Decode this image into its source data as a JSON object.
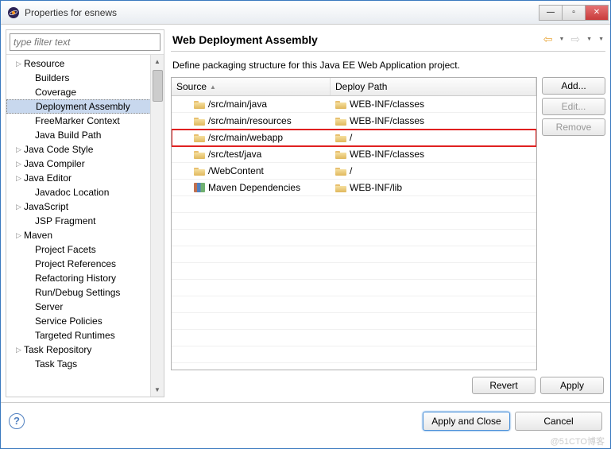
{
  "window": {
    "title": "Properties for esnews"
  },
  "filter": {
    "placeholder": "type filter text"
  },
  "tree": [
    {
      "label": "Resource",
      "expandable": true,
      "child": false
    },
    {
      "label": "Builders",
      "expandable": false,
      "child": true
    },
    {
      "label": "Coverage",
      "expandable": false,
      "child": true
    },
    {
      "label": "Deployment Assembly",
      "expandable": false,
      "child": true,
      "selected": true
    },
    {
      "label": "FreeMarker Context",
      "expandable": false,
      "child": true
    },
    {
      "label": "Java Build Path",
      "expandable": false,
      "child": true
    },
    {
      "label": "Java Code Style",
      "expandable": true,
      "child": false
    },
    {
      "label": "Java Compiler",
      "expandable": true,
      "child": false
    },
    {
      "label": "Java Editor",
      "expandable": true,
      "child": false
    },
    {
      "label": "Javadoc Location",
      "expandable": false,
      "child": true
    },
    {
      "label": "JavaScript",
      "expandable": true,
      "child": false
    },
    {
      "label": "JSP Fragment",
      "expandable": false,
      "child": true
    },
    {
      "label": "Maven",
      "expandable": true,
      "child": false
    },
    {
      "label": "Project Facets",
      "expandable": false,
      "child": true
    },
    {
      "label": "Project References",
      "expandable": false,
      "child": true
    },
    {
      "label": "Refactoring History",
      "expandable": false,
      "child": true
    },
    {
      "label": "Run/Debug Settings",
      "expandable": false,
      "child": true
    },
    {
      "label": "Server",
      "expandable": false,
      "child": true
    },
    {
      "label": "Service Policies",
      "expandable": false,
      "child": true
    },
    {
      "label": "Targeted Runtimes",
      "expandable": false,
      "child": true
    },
    {
      "label": "Task Repository",
      "expandable": true,
      "child": false
    },
    {
      "label": "Task Tags",
      "expandable": false,
      "child": true
    }
  ],
  "page": {
    "title": "Web Deployment Assembly",
    "description": "Define packaging structure for this Java EE Web Application project."
  },
  "table": {
    "headers": {
      "source": "Source",
      "deploy": "Deploy Path"
    },
    "rows": [
      {
        "source": "/src/main/java",
        "deploy": "WEB-INF/classes",
        "icon": "folder",
        "highlighted": false
      },
      {
        "source": "/src/main/resources",
        "deploy": "WEB-INF/classes",
        "icon": "folder",
        "highlighted": false
      },
      {
        "source": "/src/main/webapp",
        "deploy": "/",
        "icon": "folder",
        "highlighted": true
      },
      {
        "source": "/src/test/java",
        "deploy": "WEB-INF/classes",
        "icon": "folder",
        "highlighted": false
      },
      {
        "source": "/WebContent",
        "deploy": "/",
        "icon": "folder",
        "highlighted": false
      },
      {
        "source": "Maven Dependencies",
        "deploy": "WEB-INF/lib",
        "icon": "lib",
        "highlighted": false
      }
    ]
  },
  "buttons": {
    "add": "Add...",
    "edit": "Edit...",
    "remove": "Remove",
    "revert": "Revert",
    "apply": "Apply",
    "apply_close": "Apply and Close",
    "cancel": "Cancel"
  },
  "watermark": "@51CTO博客"
}
